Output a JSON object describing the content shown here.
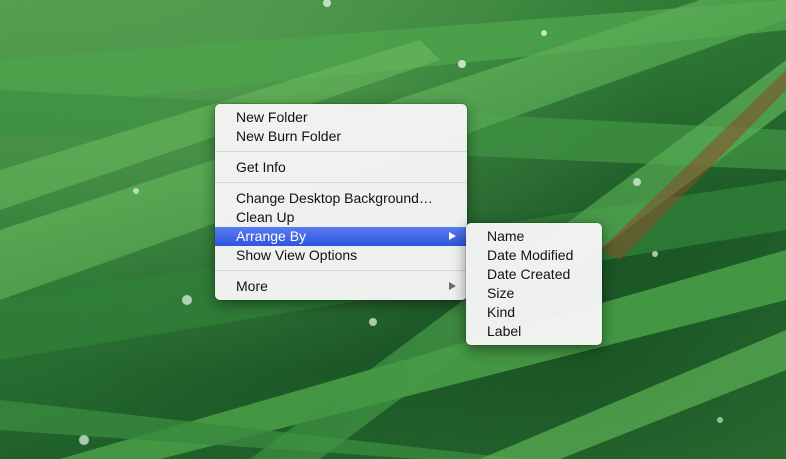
{
  "desktop": {
    "wallpaper": "green grass with water droplets",
    "colors": {
      "grass_dark": "#1f5f2a",
      "grass_light": "#6dbb5e",
      "highlight_blue": "#3a60e6"
    }
  },
  "context_menu": {
    "items": [
      {
        "label": "New Folder"
      },
      {
        "label": "New Burn Folder"
      },
      {
        "label": "Get Info"
      },
      {
        "label": "Change Desktop Background…"
      },
      {
        "label": "Clean Up"
      },
      {
        "label": "Arrange By",
        "has_submenu": true,
        "highlighted": true
      },
      {
        "label": "Show View Options"
      },
      {
        "label": "More",
        "has_submenu": true
      }
    ]
  },
  "arrange_by_submenu": {
    "items": [
      {
        "label": "Name"
      },
      {
        "label": "Date Modified"
      },
      {
        "label": "Date Created"
      },
      {
        "label": "Size"
      },
      {
        "label": "Kind"
      },
      {
        "label": "Label"
      }
    ]
  }
}
